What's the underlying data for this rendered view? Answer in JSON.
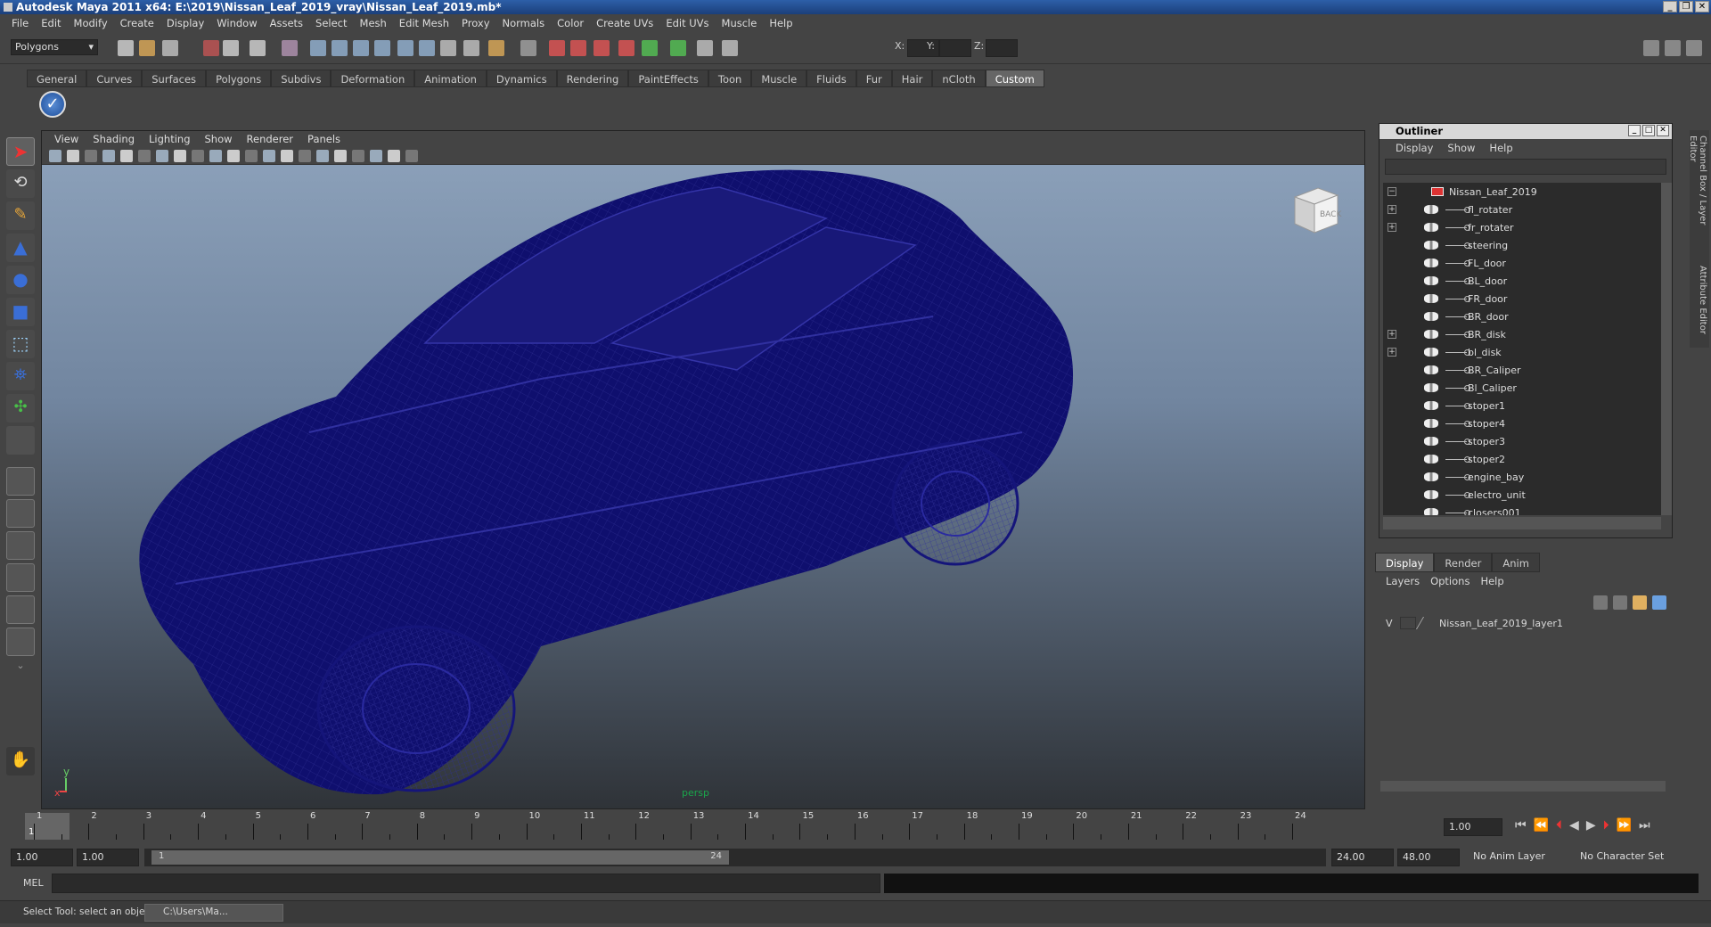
{
  "window": {
    "title": "Autodesk Maya 2011 x64: E:\\2019\\Nissan_Leaf_2019_vray\\Nissan_Leaf_2019.mb*"
  },
  "menubar": [
    "File",
    "Edit",
    "Modify",
    "Create",
    "Display",
    "Window",
    "Assets",
    "Select",
    "Mesh",
    "Edit Mesh",
    "Proxy",
    "Normals",
    "Color",
    "Create UVs",
    "Edit UVs",
    "Muscle",
    "Help"
  ],
  "status": {
    "mode": "Polygons",
    "x_label": "X:",
    "y_label": "Y:",
    "z_label": "Z:"
  },
  "shelf_tabs": [
    "General",
    "Curves",
    "Surfaces",
    "Polygons",
    "Subdivs",
    "Deformation",
    "Animation",
    "Dynamics",
    "Rendering",
    "PaintEffects",
    "Toon",
    "Muscle",
    "Fluids",
    "Fur",
    "Hair",
    "nCloth",
    "Custom"
  ],
  "shelf_active": "Custom",
  "viewport": {
    "menu": [
      "View",
      "Shading",
      "Lighting",
      "Show",
      "Renderer",
      "Panels"
    ],
    "camera_label": "persp",
    "viewcube_label": "BACK",
    "axis_x": "x",
    "axis_y": "y",
    "wire_color": "#0f0f6e"
  },
  "outliner": {
    "title": "Outliner",
    "menu": [
      "Display",
      "Show",
      "Help"
    ],
    "root": "Nissan_Leaf_2019",
    "items": [
      {
        "label": "fl_rotater",
        "expand": "+"
      },
      {
        "label": "fr_rotater",
        "expand": "+"
      },
      {
        "label": "steering",
        "expand": ""
      },
      {
        "label": "FL_door",
        "expand": ""
      },
      {
        "label": "BL_door",
        "expand": ""
      },
      {
        "label": "FR_door",
        "expand": ""
      },
      {
        "label": "BR_door",
        "expand": ""
      },
      {
        "label": "BR_disk",
        "expand": "+"
      },
      {
        "label": "bl_disk",
        "expand": "+"
      },
      {
        "label": "BR_Caliper",
        "expand": ""
      },
      {
        "label": "Bl_Caliper",
        "expand": ""
      },
      {
        "label": "stoper1",
        "expand": ""
      },
      {
        "label": "stoper4",
        "expand": ""
      },
      {
        "label": "stoper3",
        "expand": ""
      },
      {
        "label": "stoper2",
        "expand": ""
      },
      {
        "label": "engine_bay",
        "expand": ""
      },
      {
        "label": "electro_unit",
        "expand": ""
      },
      {
        "label": "closers001",
        "expand": ""
      }
    ]
  },
  "layers": {
    "tabs": [
      "Display",
      "Render",
      "Anim"
    ],
    "active_tab": "Display",
    "menu": [
      "Layers",
      "Options",
      "Help"
    ],
    "layer_vis": "V",
    "layer_name": "Nissan_Leaf_2019_layer1"
  },
  "side_tabs": [
    "Channel Box / Layer Editor",
    "Attribute Editor"
  ],
  "timeline": {
    "frames": [
      "1",
      "2",
      "3",
      "4",
      "5",
      "6",
      "7",
      "8",
      "9",
      "10",
      "11",
      "12",
      "13",
      "14",
      "15",
      "16",
      "17",
      "18",
      "19",
      "20",
      "21",
      "22",
      "23",
      "24"
    ],
    "current_frame_marker": "1",
    "current_time": "1.00"
  },
  "range": {
    "start": "1.00",
    "playback_start": "1.00",
    "slider_start": "1",
    "slider_end": "24",
    "playback_end": "24.00",
    "end": "48.00",
    "anim_layer": "No Anim Layer",
    "char_set": "No Character Set"
  },
  "cmd": {
    "label": "MEL"
  },
  "help": {
    "text": "Select Tool: select an object",
    "task": "C:\\Users\\Ma..."
  }
}
